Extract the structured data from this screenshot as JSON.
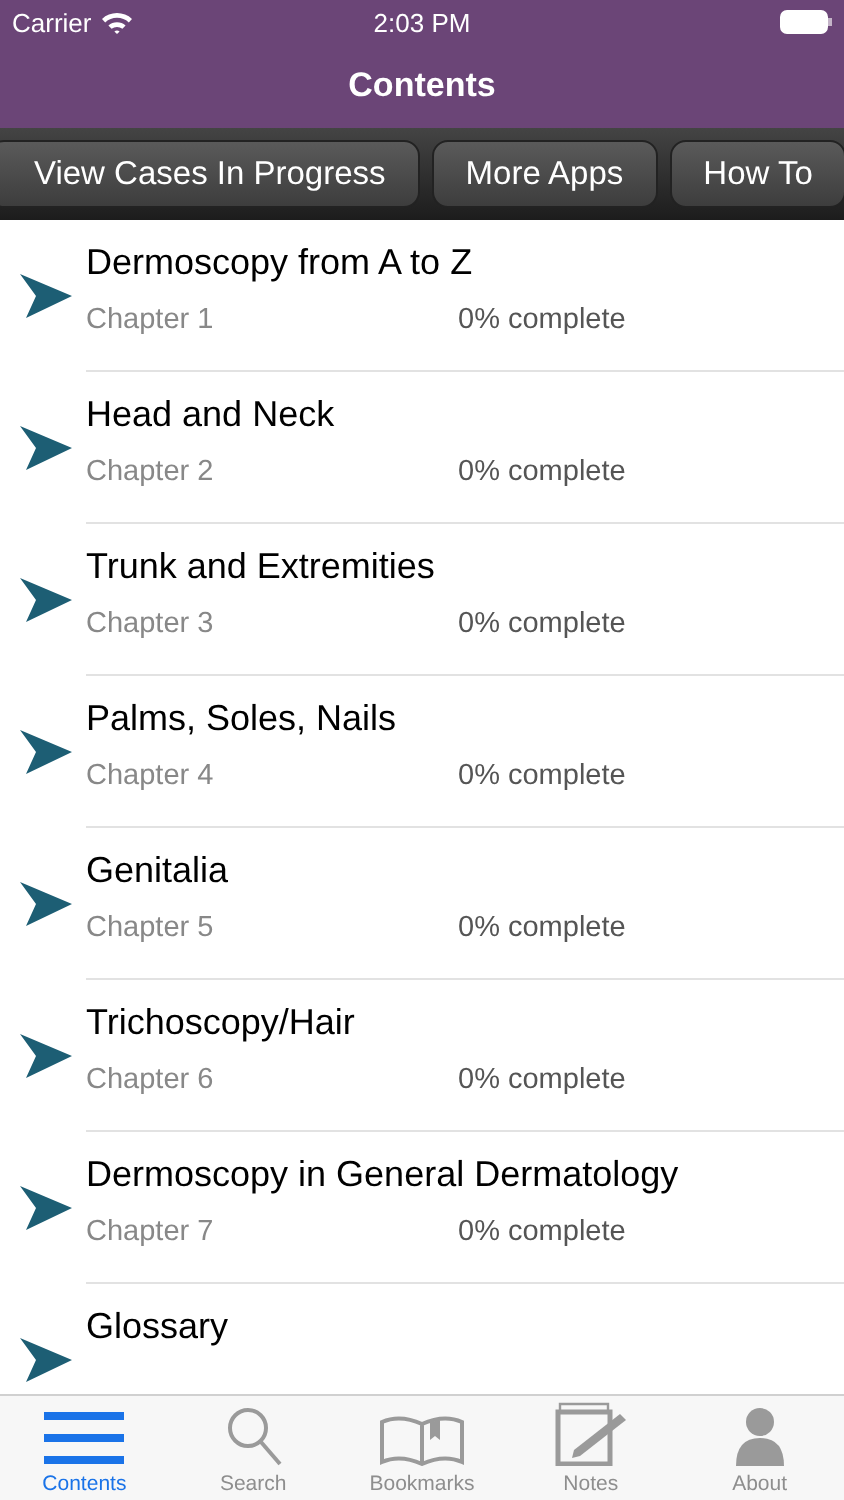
{
  "status_bar": {
    "carrier": "Carrier",
    "time": "2:03 PM"
  },
  "nav_bar": {
    "title": "Contents"
  },
  "toolbar": {
    "buttons": [
      "View Cases In Progress",
      "More Apps",
      "How To"
    ]
  },
  "chapters": [
    {
      "title": "Dermoscopy from A to Z",
      "chapter": "Chapter 1",
      "progress": "0% complete"
    },
    {
      "title": "Head and Neck",
      "chapter": "Chapter 2",
      "progress": "0% complete"
    },
    {
      "title": "Trunk and Extremities",
      "chapter": "Chapter 3",
      "progress": "0% complete"
    },
    {
      "title": "Palms, Soles, Nails",
      "chapter": "Chapter 4",
      "progress": "0% complete"
    },
    {
      "title": "Genitalia",
      "chapter": "Chapter 5",
      "progress": "0% complete"
    },
    {
      "title": "Trichoscopy/Hair",
      "chapter": "Chapter 6",
      "progress": "0% complete"
    },
    {
      "title": "Dermoscopy in General Dermatology",
      "chapter": "Chapter 7",
      "progress": "0% complete"
    },
    {
      "title": "Glossary"
    }
  ],
  "tab_bar": [
    {
      "kind": "contents",
      "label": "Contents",
      "selected": true
    },
    {
      "kind": "search",
      "label": "Search",
      "selected": false
    },
    {
      "kind": "bookmarks",
      "label": "Bookmarks",
      "selected": false
    },
    {
      "kind": "notes",
      "label": "Notes",
      "selected": false
    },
    {
      "kind": "about",
      "label": "About",
      "selected": false
    }
  ]
}
